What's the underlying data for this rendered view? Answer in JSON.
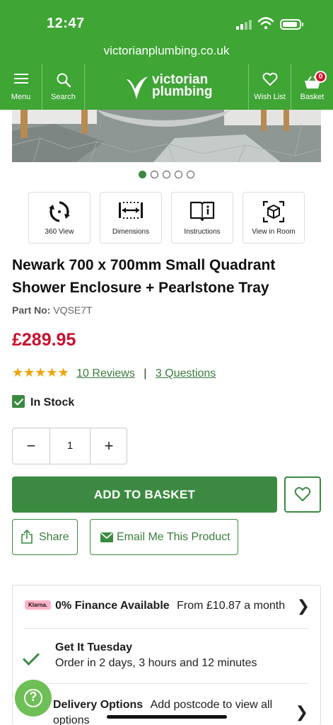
{
  "status_bar": {
    "time": "12:47"
  },
  "browser": {
    "url": "victorianplumbing.co.uk"
  },
  "nav": {
    "menu_label": "Menu",
    "search_label": "Search",
    "logo_line1": "victorian",
    "logo_line2": "plumbing",
    "wishlist_label": "Wish List",
    "basket_label": "Basket",
    "basket_count": "0"
  },
  "gallery": {
    "dot_count": 5,
    "active_index": 0
  },
  "tools": [
    {
      "label": "360 View",
      "icon": "rotate-360-icon"
    },
    {
      "label": "Dimensions",
      "icon": "ruler-icon"
    },
    {
      "label": "Instructions",
      "icon": "book-info-icon"
    },
    {
      "label": "View in Room",
      "icon": "cube-icon"
    }
  ],
  "product": {
    "title": "Newark 700 x 700mm Small Quadrant Shower Enclosure + Pearlstone Tray",
    "part_label": "Part No:",
    "part_number": "VQSE7T",
    "price": "£289.95",
    "stars": "★★★★★",
    "rating_value": 5,
    "reviews_link": "10 Reviews",
    "questions_link": "3 Questions",
    "stock": "In Stock"
  },
  "quantity": {
    "minus": "−",
    "value": "1",
    "plus": "+"
  },
  "actions": {
    "add_to_basket": "ADD TO BASKET",
    "share": "Share",
    "email": "Email Me This Product"
  },
  "info": {
    "klarna_badge": "Klarna.",
    "finance_title": "0% Finance Available",
    "finance_detail": "From £10.87 a month",
    "delivery_title": "Get It Tuesday",
    "delivery_detail": "Order in 2 days, 3 hours and 12 minutes",
    "options_title": "Delivery Options",
    "options_detail": "Add postcode to view all options"
  },
  "help": {
    "label": "?"
  },
  "colors": {
    "brand_green": "#3fa535",
    "button_green": "#3c8a41",
    "price_red": "#c8102e",
    "star_gold": "#f2a200"
  }
}
